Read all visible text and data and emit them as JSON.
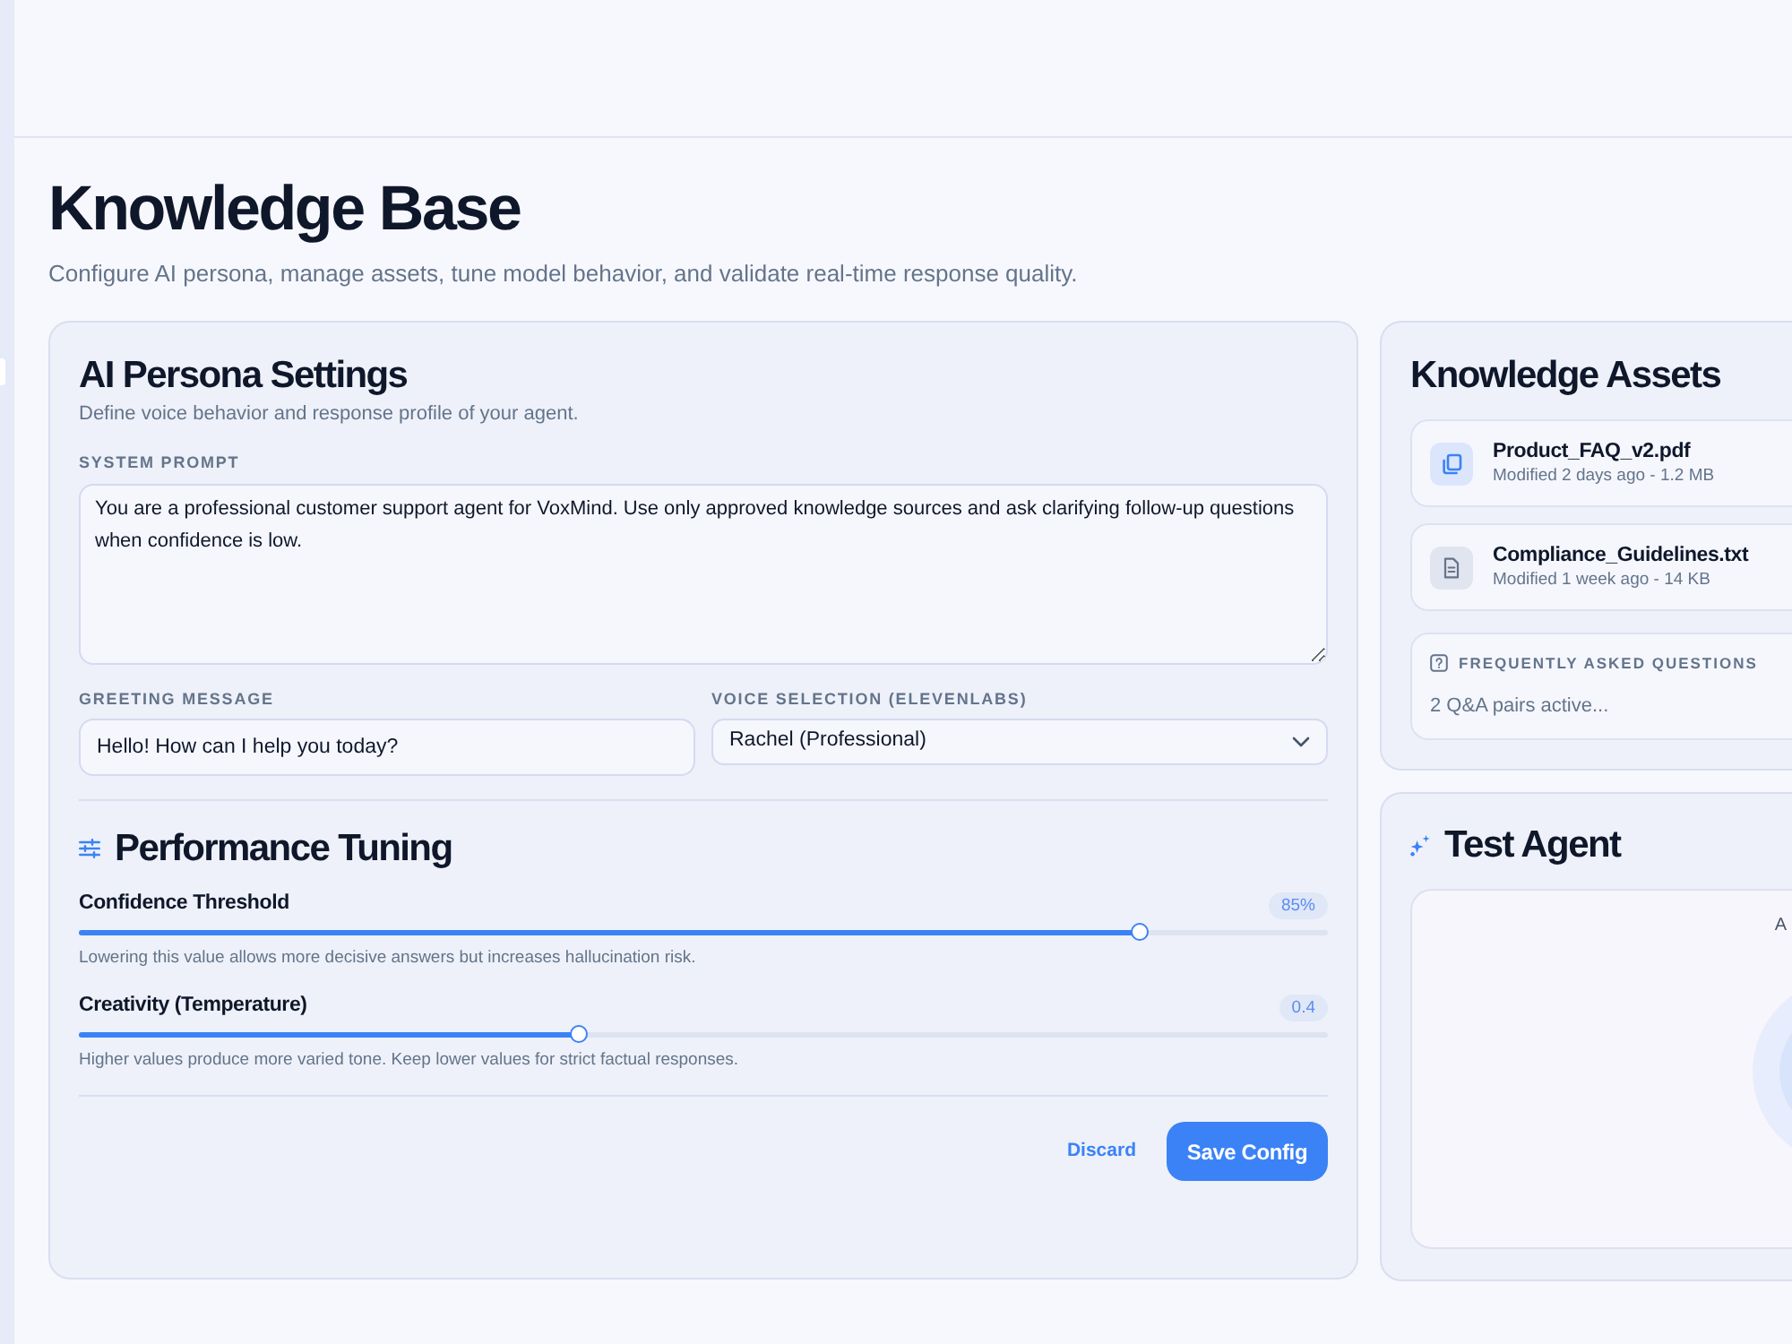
{
  "page": {
    "title": "Knowledge Base",
    "subtitle": "Configure AI persona, manage assets, tune model behavior, and validate real-time response quality."
  },
  "persona_settings": {
    "title": "AI Persona Settings",
    "subtitle": "Define voice behavior and response profile of your agent.",
    "system_prompt": {
      "label": "SYSTEM PROMPT",
      "value": "You are a professional customer support agent for VoxMind. Use only approved knowledge sources and ask clarifying follow-up questions when confidence is low."
    },
    "greeting": {
      "label": "GREETING MESSAGE",
      "value": "Hello! How can I help you today?"
    },
    "voice": {
      "label": "VOICE SELECTION (ELEVENLABS)",
      "value": "Rachel (Professional)"
    }
  },
  "performance_tuning": {
    "title": "Performance Tuning",
    "sliders": [
      {
        "label": "Confidence Threshold",
        "reading": "85%",
        "level": 0.85,
        "hint": "Lowering this value allows more decisive answers but increases hallucination risk."
      },
      {
        "label": "Creativity (Temperature)",
        "reading": "0.4",
        "level": 0.4,
        "hint": "Higher values produce more varied tone. Keep lower values for strict factual responses."
      }
    ]
  },
  "actions": [
    {
      "label": "Discard",
      "kind": "link"
    },
    {
      "label": "Save Config",
      "kind": "primary"
    }
  ],
  "knowledge_assets": {
    "title": "Knowledge Assets",
    "files": [
      {
        "name": "Product_FAQ_v2.pdf",
        "meta": "Modified 2 days ago - 1.2 MB",
        "kind": "pdf"
      },
      {
        "name": "Compliance_Guidelines.txt",
        "meta": "Modified 1 week ago - 14 KB",
        "kind": "text"
      }
    ],
    "faq": {
      "title": "FREQUENTLY ASKED QUESTIONS",
      "summary": "2 Q&A pairs active..."
    }
  },
  "test_agent": {
    "title": "Test Agent",
    "status": "A"
  }
}
